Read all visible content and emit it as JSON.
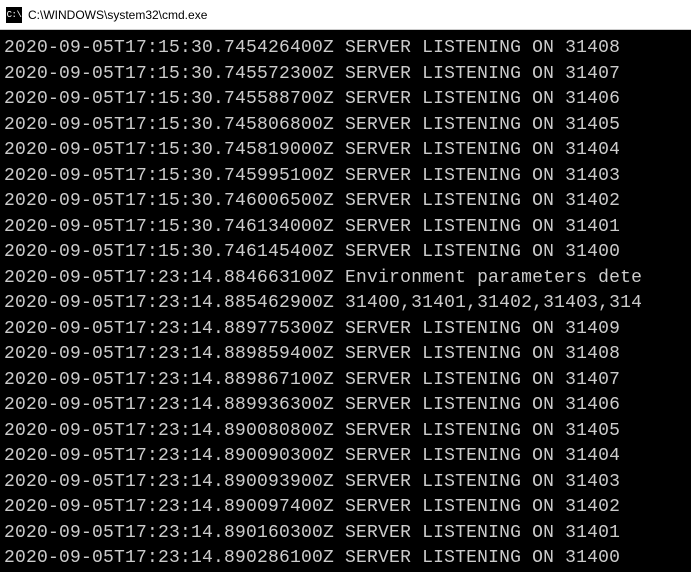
{
  "window": {
    "icon_label": "C:\\",
    "title": "C:\\WINDOWS\\system32\\cmd.exe"
  },
  "log_lines": [
    "2020-09-05T17:15:30.745426400Z SERVER LISTENING ON 31408",
    "2020-09-05T17:15:30.745572300Z SERVER LISTENING ON 31407",
    "2020-09-05T17:15:30.745588700Z SERVER LISTENING ON 31406",
    "2020-09-05T17:15:30.745806800Z SERVER LISTENING ON 31405",
    "2020-09-05T17:15:30.745819000Z SERVER LISTENING ON 31404",
    "2020-09-05T17:15:30.745995100Z SERVER LISTENING ON 31403",
    "2020-09-05T17:15:30.746006500Z SERVER LISTENING ON 31402",
    "2020-09-05T17:15:30.746134000Z SERVER LISTENING ON 31401",
    "2020-09-05T17:15:30.746145400Z SERVER LISTENING ON 31400",
    "2020-09-05T17:23:14.884663100Z Environment parameters dete",
    "2020-09-05T17:23:14.885462900Z 31400,31401,31402,31403,314",
    "2020-09-05T17:23:14.889775300Z SERVER LISTENING ON 31409",
    "2020-09-05T17:23:14.889859400Z SERVER LISTENING ON 31408",
    "2020-09-05T17:23:14.889867100Z SERVER LISTENING ON 31407",
    "2020-09-05T17:23:14.889936300Z SERVER LISTENING ON 31406",
    "2020-09-05T17:23:14.890080800Z SERVER LISTENING ON 31405",
    "2020-09-05T17:23:14.890090300Z SERVER LISTENING ON 31404",
    "2020-09-05T17:23:14.890093900Z SERVER LISTENING ON 31403",
    "2020-09-05T17:23:14.890097400Z SERVER LISTENING ON 31402",
    "2020-09-05T17:23:14.890160300Z SERVER LISTENING ON 31401",
    "2020-09-05T17:23:14.890286100Z SERVER LISTENING ON 31400"
  ]
}
